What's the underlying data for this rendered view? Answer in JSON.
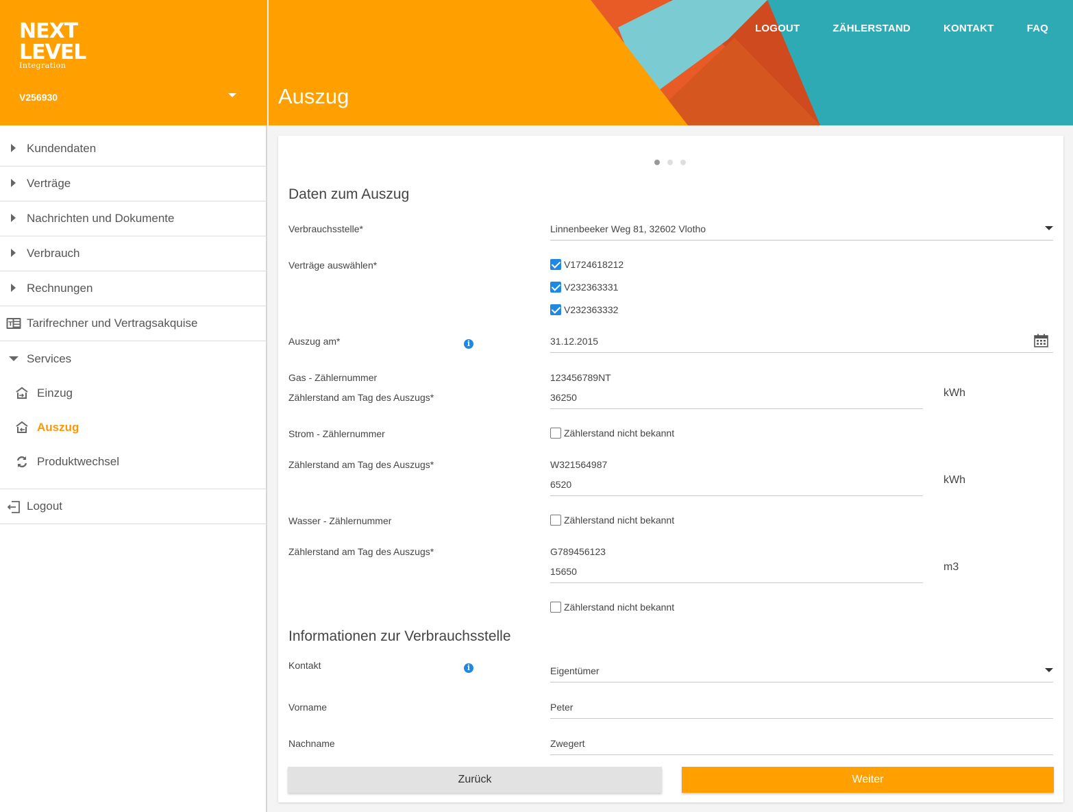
{
  "brand": {
    "line1": "NEXT",
    "line2": "LEVEL",
    "sub": "Integration"
  },
  "account": {
    "number": "V256930"
  },
  "sidebar": {
    "items": [
      {
        "label": "Kundendaten"
      },
      {
        "label": "Verträge"
      },
      {
        "label": "Nachrichten und Dokumente"
      },
      {
        "label": "Verbrauch"
      },
      {
        "label": "Rechnungen"
      },
      {
        "label": "Tarifrechner und Vertragsakquise"
      }
    ],
    "services": {
      "label": "Services",
      "children": [
        {
          "label": "Einzug"
        },
        {
          "label": "Auszug"
        },
        {
          "label": "Produktwechsel"
        }
      ]
    },
    "logout": "Logout"
  },
  "header": {
    "title": "Auszug",
    "nav": [
      "LOGOUT",
      "ZÄHLERSTAND",
      "KONTAKT",
      "FAQ"
    ]
  },
  "form": {
    "section1": "Daten zum Auszug",
    "verbrauchsstelle": {
      "label": "Verbrauchsstelle*",
      "value": "Linnenbeeker Weg 81, 32602 Vlotho"
    },
    "vertraege": {
      "label": "Verträge auswählen*",
      "options": [
        "V1724618212",
        "V232363331",
        "V232363332"
      ]
    },
    "auszug_am": {
      "label": "Auszug am*",
      "value": "31.12.2015"
    },
    "gas": {
      "label": "Gas - Zählernummer",
      "number": "123456789NT",
      "reading_label": "Zählerstand am Tag des Auszugs*",
      "reading": "36250",
      "unit": "kWh",
      "unknown": "Zählerstand nicht bekannt"
    },
    "strom": {
      "label": "Strom - Zählernummer",
      "number": "W321564987",
      "reading_label": "Zählerstand am Tag des Auszugs*",
      "reading": "6520",
      "unit": "kWh",
      "unknown": "Zählerstand nicht bekannt"
    },
    "wasser": {
      "label": "Wasser - Zählernummer",
      "number": "G789456123",
      "reading_label": "Zählerstand am Tag des Auszugs*",
      "reading": "15650",
      "unit": "m3",
      "unknown": "Zählerstand nicht bekannt"
    },
    "section2": "Informationen zur Verbrauchsstelle",
    "kontakt": {
      "label": "Kontakt",
      "value": "Eigentümer"
    },
    "vorname": {
      "label": "Vorname",
      "value": "Peter"
    },
    "nachname": {
      "label": "Nachname",
      "value": "Zwegert"
    },
    "back_label": "Zurück",
    "next_label": "Weiter"
  },
  "colors": {
    "accent": "#ffa000",
    "teal": "#2eaab5",
    "blue": "#1e88e5",
    "red": "#e0522a"
  }
}
